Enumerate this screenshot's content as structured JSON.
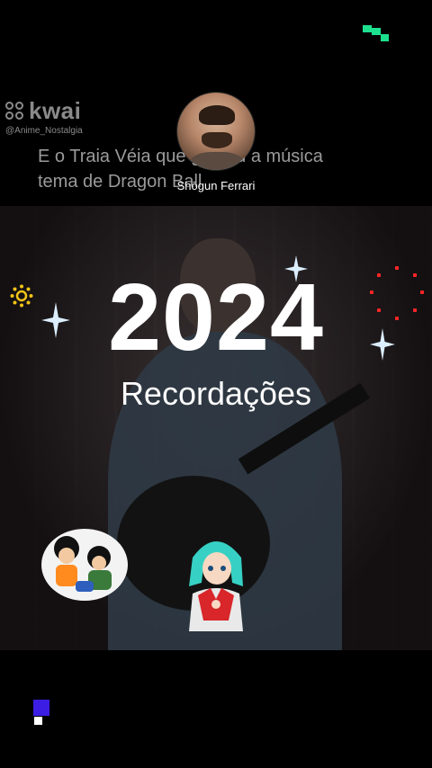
{
  "watermark": {
    "brand": "kwai",
    "handle": "@Anime_Nostalgia"
  },
  "caption": {
    "line1": "E o Traia Véia que gravou a música",
    "line2": "tema de Dragon Ball"
  },
  "profile": {
    "name": "Shōgun Ferrari"
  },
  "overlay": {
    "year": "2024",
    "subtitle": "Recordações"
  },
  "colors": {
    "accent_green": "#1de08f",
    "accent_purple": "#3b1de3",
    "accent_red": "#ff2626"
  },
  "icons": [
    "kwai-logo-icon",
    "sparkle-icon",
    "sun-icon",
    "dots-circle-icon"
  ]
}
